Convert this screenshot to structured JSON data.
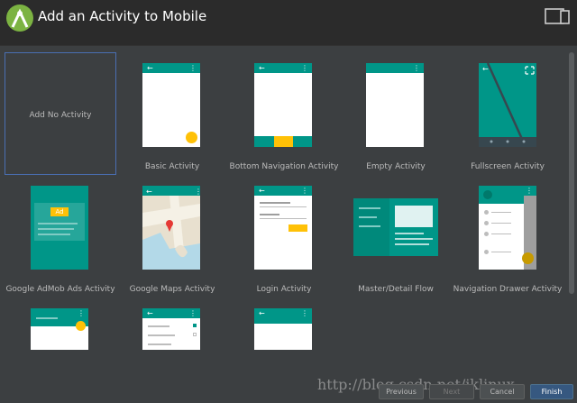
{
  "header": {
    "title": "Add an Activity to Mobile",
    "logo_icon": "android-studio-logo-icon",
    "device_icon": "device-layout-icon"
  },
  "activities": [
    {
      "label": "Add No Activity",
      "selected": true
    },
    {
      "label": "Basic Activity"
    },
    {
      "label": "Bottom Navigation Activity"
    },
    {
      "label": "Empty Activity"
    },
    {
      "label": "Fullscreen Activity"
    },
    {
      "label": "Google AdMob Ads Activity",
      "ad_badge": "Ad"
    },
    {
      "label": "Google Maps Activity"
    },
    {
      "label": "Login Activity"
    },
    {
      "label": "Master/Detail Flow"
    },
    {
      "label": "Navigation Drawer Activity"
    }
  ],
  "buttons": {
    "previous": "Previous",
    "next": "Next",
    "cancel": "Cancel",
    "finish": "Finish"
  },
  "watermark": "http://blog.csdn.net/jklinux",
  "colors": {
    "teal": "#009688",
    "amber": "#ffc107",
    "selection_border": "#4a6fb2",
    "background": "#3c3f41"
  }
}
